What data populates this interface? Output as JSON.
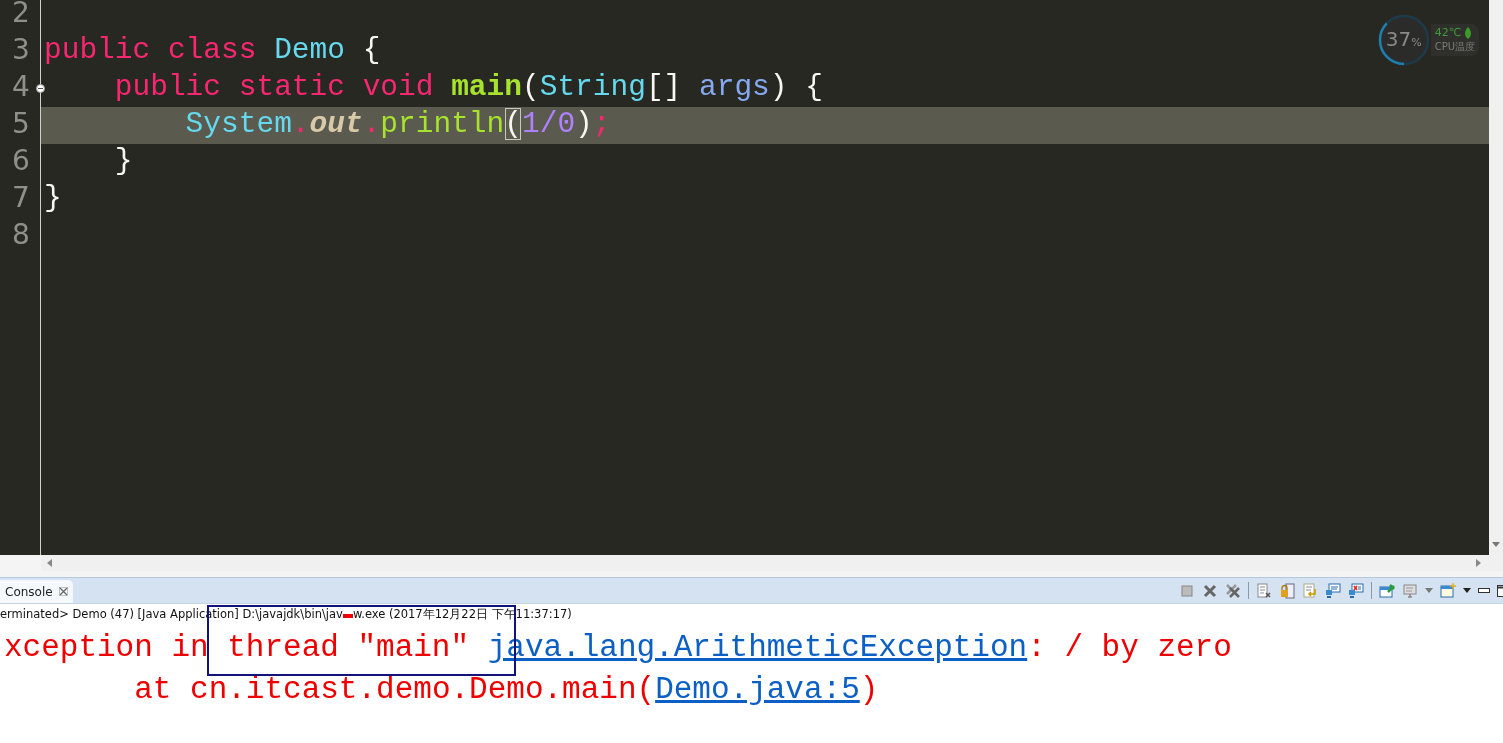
{
  "editor": {
    "lines": [
      {
        "number": "2",
        "current": false,
        "foldable": false
      },
      {
        "number": "3",
        "current": false,
        "foldable": false,
        "tokens": [
          {
            "kind": "keyword",
            "text": "public class "
          },
          {
            "kind": "type",
            "text": "Demo"
          },
          {
            "kind": "plain",
            "text": " {"
          }
        ]
      },
      {
        "number": "4",
        "current": false,
        "foldable": true,
        "tokens": [
          {
            "kind": "keyword",
            "text": "    public static void "
          },
          {
            "kind": "declaration",
            "text": "main"
          },
          {
            "kind": "plain",
            "text": "("
          },
          {
            "kind": "type",
            "text": "String"
          },
          {
            "kind": "plain",
            "text": "[] "
          },
          {
            "kind": "param",
            "text": "args"
          },
          {
            "kind": "plain",
            "text": ") {"
          }
        ]
      },
      {
        "number": "5",
        "current": true,
        "foldable": false,
        "tokens": [
          {
            "kind": "type",
            "text": "        System"
          },
          {
            "kind": "operator",
            "text": "."
          },
          {
            "kind": "field",
            "text": "out"
          },
          {
            "kind": "operator",
            "text": "."
          },
          {
            "kind": "method",
            "text": "println"
          },
          {
            "kind": "bracket",
            "text": "("
          },
          {
            "kind": "number",
            "text": "1/0"
          },
          {
            "kind": "plain",
            "text": ")"
          },
          {
            "kind": "operator",
            "text": ";"
          }
        ]
      },
      {
        "number": "6",
        "current": false,
        "foldable": false,
        "tokens": [
          {
            "kind": "plain",
            "text": "    }"
          }
        ]
      },
      {
        "number": "7",
        "current": false,
        "foldable": false,
        "tokens": [
          {
            "kind": "plain",
            "text": "}"
          }
        ]
      },
      {
        "number": "8",
        "current": false,
        "foldable": false
      }
    ]
  },
  "cpu_widget": {
    "percent": "37",
    "unit": "%",
    "level": 0.37,
    "temperature": "42℃",
    "label": "CPU温度"
  },
  "console": {
    "tab": {
      "label": "Console",
      "selected": true
    },
    "status": {
      "before": "erminated> Demo (47) [Java Application] D:\\javajdk\\bin\\jav",
      "redacted": true,
      "after": "w.exe (2017年12月22日 下午11:37:17)"
    },
    "output": [
      {
        "segments": [
          {
            "kind": "text",
            "text": "xception in thread \"main\" "
          },
          {
            "kind": "link",
            "text": "java.lang.ArithmeticException"
          },
          {
            "kind": "text",
            "text": ": / by zero"
          }
        ]
      },
      {
        "segments": [
          {
            "kind": "text",
            "text": "\tat cn.itcast.demo.Demo.main("
          },
          {
            "kind": "link",
            "text": "Demo.java:5"
          },
          {
            "kind": "text",
            "text": ")"
          }
        ]
      }
    ],
    "highlight_box": true
  }
}
